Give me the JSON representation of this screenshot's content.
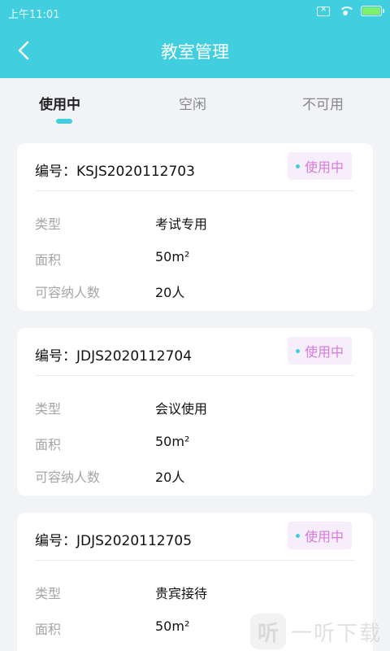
{
  "status_bar": {
    "time": "上午11:01"
  },
  "header": {
    "title": "教室管理"
  },
  "tabs": [
    {
      "label": "使用中",
      "active": true
    },
    {
      "label": "空闲",
      "active": false
    },
    {
      "label": "不可用",
      "active": false
    }
  ],
  "rooms": [
    {
      "id": "编号：KSJS2020112703",
      "status": "使用中",
      "type_label": "类型",
      "type": "考试专用",
      "area_label": "面积",
      "area": "50m²",
      "capacity_label": "可容纳人数",
      "capacity": "20人"
    },
    {
      "id": "编号：JDJS2020112704",
      "status": "使用中",
      "type_label": "类型",
      "type": "会议使用",
      "area_label": "面积",
      "area": "50m²",
      "capacity_label": "可容纳人数",
      "capacity": "20人"
    },
    {
      "id": "编号：JDJS2020112705",
      "status": "使用中",
      "type_label": "类型",
      "type": "贵宾接待",
      "area_label": "面积",
      "area": "50m²"
    }
  ],
  "watermark": {
    "logo_text": "听",
    "text": "一听下载"
  },
  "colors": {
    "accent": "#41cfdf",
    "badge_text": "#d77ad9",
    "badge_bg": "#f7eefc"
  }
}
